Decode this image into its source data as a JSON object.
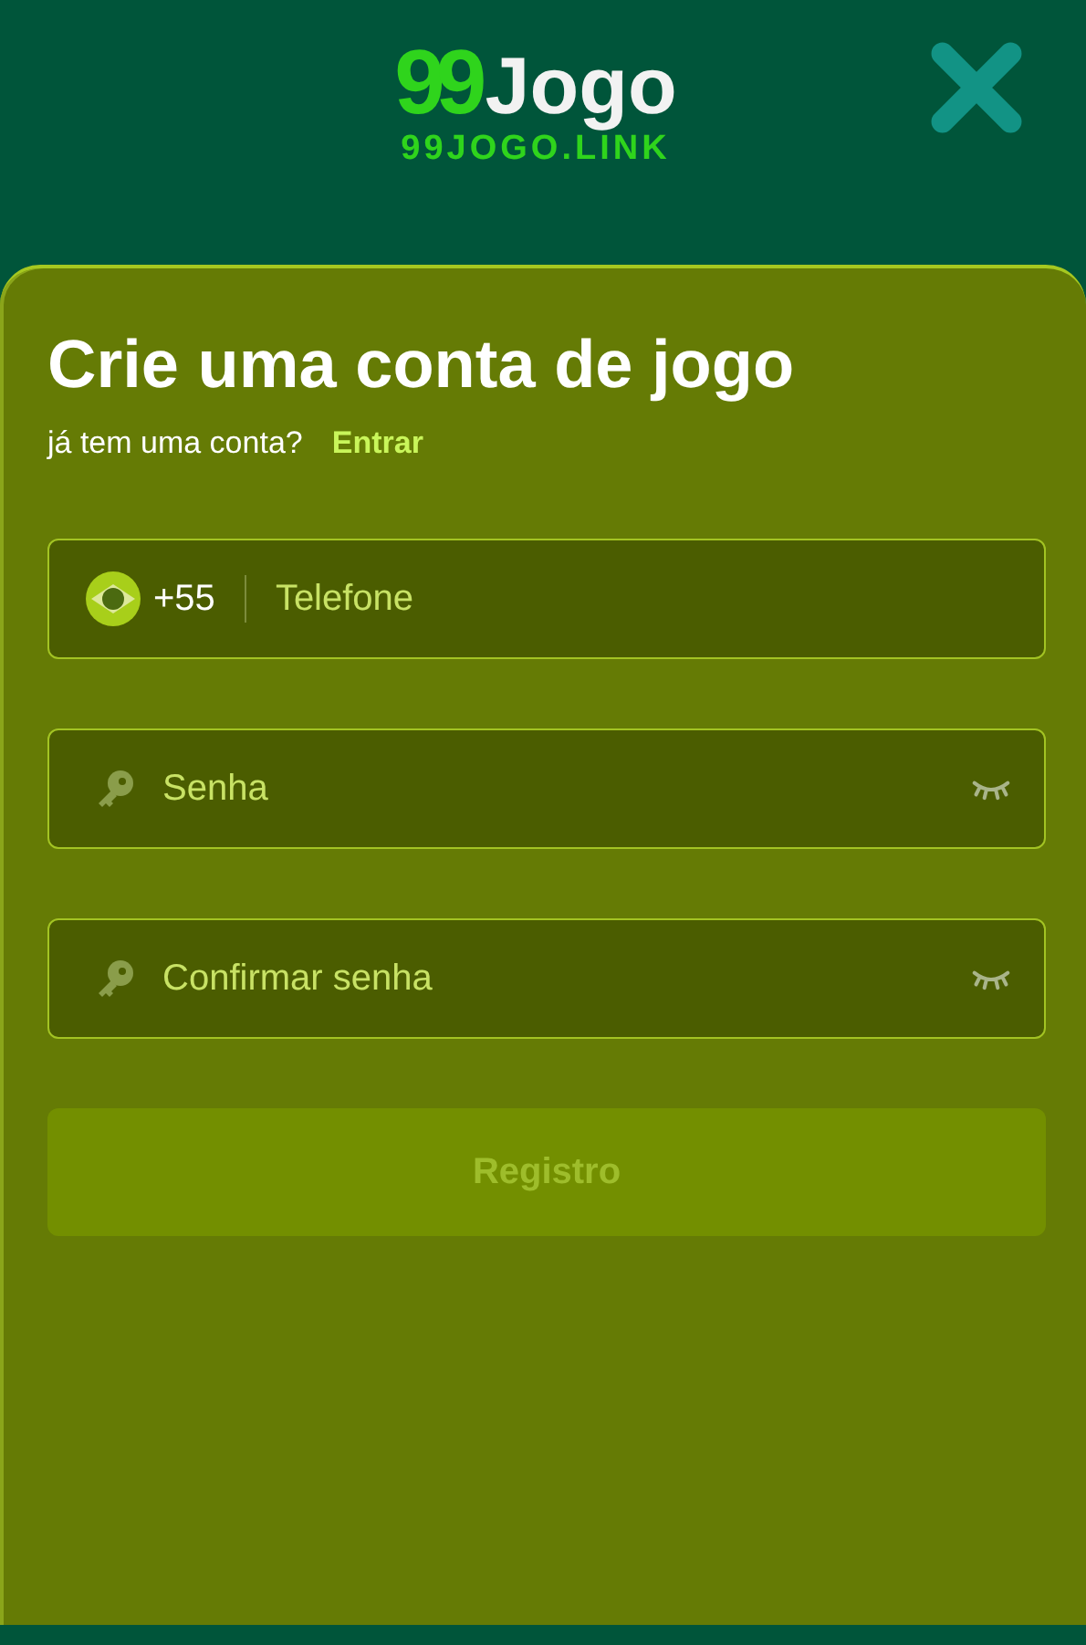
{
  "header": {
    "logo": {
      "number": "99",
      "word": "Jogo",
      "domain": "99JOGO.LINK"
    }
  },
  "form": {
    "title": "Crie uma conta de jogo",
    "prompt": "já tem uma conta?",
    "login_link": "Entrar",
    "fields": [
      {
        "kind": "phone",
        "prefix": "+55",
        "placeholder": "Telefone"
      },
      {
        "kind": "password",
        "placeholder": "Senha"
      },
      {
        "kind": "password",
        "placeholder": "Confirmar senha"
      }
    ],
    "submit": {
      "label": "Registro",
      "disabled": true
    }
  }
}
